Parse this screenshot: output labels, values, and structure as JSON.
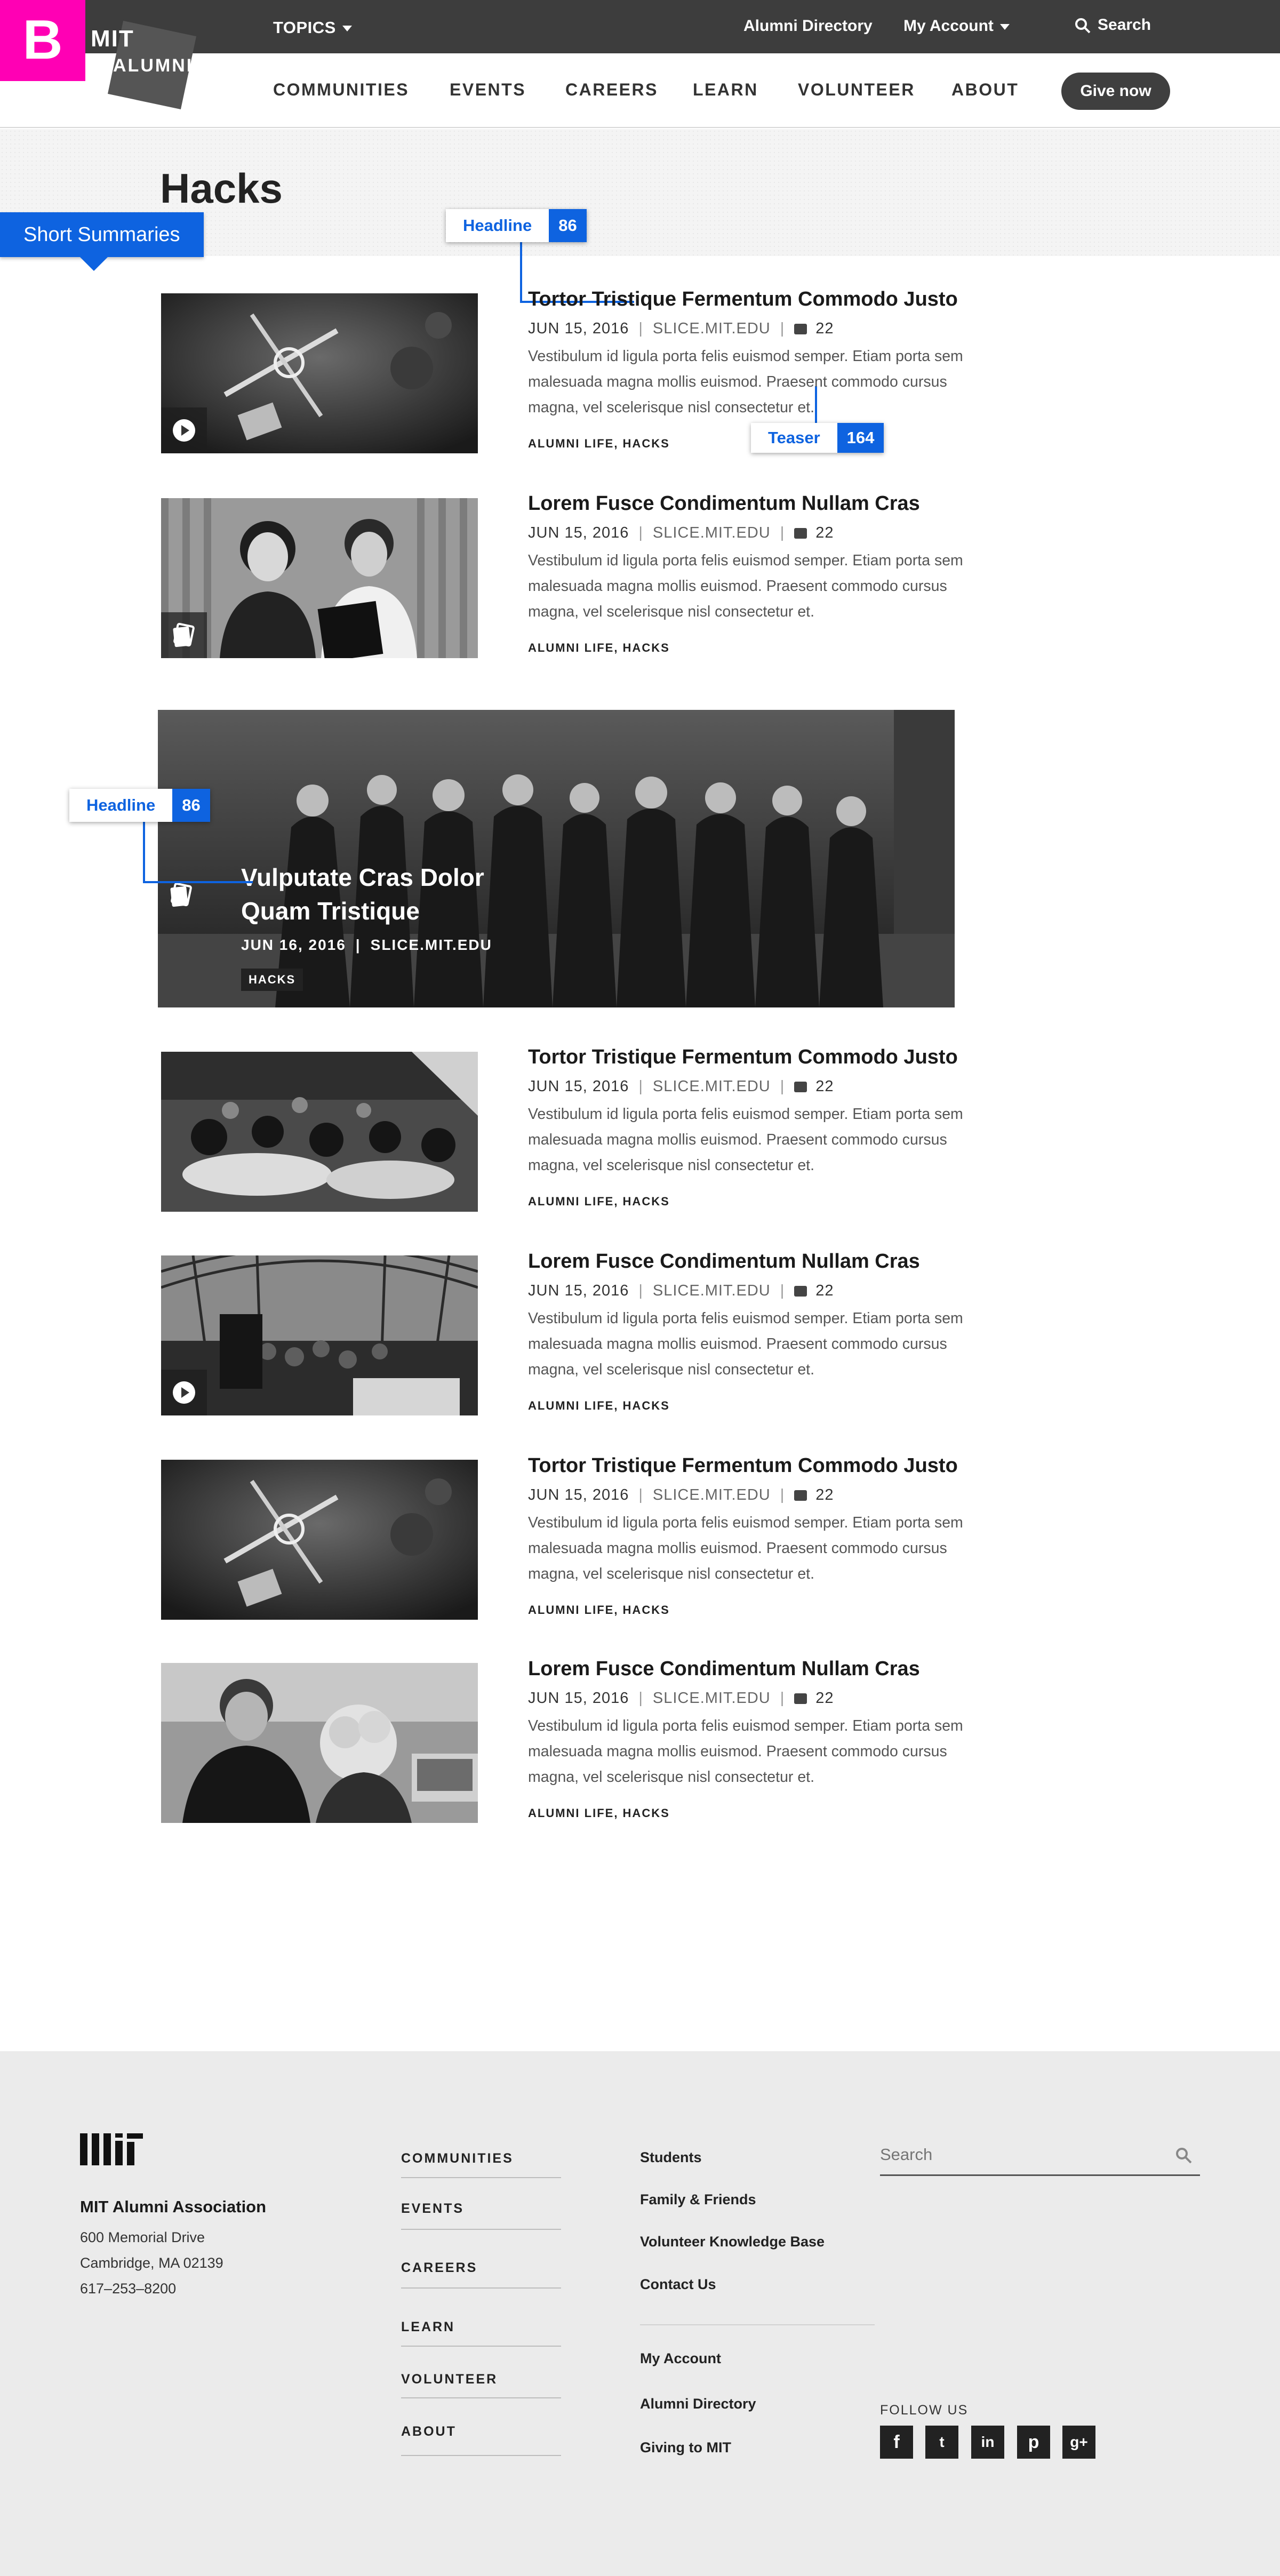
{
  "badge": {
    "letter": "B"
  },
  "logo": {
    "line1": "MIT",
    "line2": "ALUMNI"
  },
  "topbar": {
    "topics_label": "TOPICS",
    "directory_label": "Alumni Directory",
    "account_label": "My Account",
    "search_label": "Search"
  },
  "nav": {
    "items": [
      "COMMUNITIES",
      "EVENTS",
      "CAREERS",
      "LEARN",
      "VOLUNTEER",
      "ABOUT"
    ],
    "give_label": "Give now"
  },
  "page": {
    "title": "Hacks"
  },
  "annotations": {
    "section_tab": "Short Summaries",
    "headline_label": "Headline",
    "headline_count": "86",
    "teaser_label": "Teaser",
    "teaser_count": "164",
    "featured_headline_label": "Headline",
    "featured_headline_count": "86"
  },
  "articles": [
    {
      "title": "Tortor Tristique Fermentum Commodo Justo",
      "date": "JUN 15, 2016",
      "source": "SLICE.MIT.EDU",
      "comments": "22",
      "teaser": "Vestibulum id ligula porta felis euismod semper. Etiam porta sem malesuada magna mollis euismod. Praesent commodo cursus magna, vel scelerisque nisl consectetur et.",
      "tags": "ALUMNI LIFE, HACKS",
      "media": "video"
    },
    {
      "title": "Lorem Fusce Condimentum Nullam Cras",
      "date": "JUN 15, 2016",
      "source": "SLICE.MIT.EDU",
      "comments": "22",
      "teaser": "Vestibulum id ligula porta felis euismod semper. Etiam porta sem malesuada magna mollis euismod. Praesent commodo cursus magna, vel scelerisque nisl consectetur et.",
      "tags": "ALUMNI LIFE, HACKS",
      "media": "gallery"
    },
    {
      "title": "Tortor Tristique Fermentum Commodo Justo",
      "date": "JUN 15, 2016",
      "source": "SLICE.MIT.EDU",
      "comments": "22",
      "teaser": "Vestibulum id ligula porta felis euismod semper. Etiam porta sem malesuada magna mollis euismod. Praesent commodo cursus magna, vel scelerisque nisl consectetur et.",
      "tags": "ALUMNI LIFE, HACKS",
      "media": "none"
    },
    {
      "title": "Lorem Fusce Condimentum Nullam Cras",
      "date": "JUN 15, 2016",
      "source": "SLICE.MIT.EDU",
      "comments": "22",
      "teaser": "Vestibulum id ligula porta felis euismod semper. Etiam porta sem malesuada magna mollis euismod. Praesent commodo cursus magna, vel scelerisque nisl consectetur et.",
      "tags": "ALUMNI LIFE, HACKS",
      "media": "video"
    },
    {
      "title": "Tortor Tristique Fermentum Commodo Justo",
      "date": "JUN 15, 2016",
      "source": "SLICE.MIT.EDU",
      "comments": "22",
      "teaser": "Vestibulum id ligula porta felis euismod semper. Etiam porta sem malesuada magna mollis euismod. Praesent commodo cursus magna, vel scelerisque nisl consectetur et.",
      "tags": "ALUMNI LIFE, HACKS",
      "media": "none"
    },
    {
      "title": "Lorem Fusce Condimentum Nullam Cras",
      "date": "JUN 15, 2016",
      "source": "SLICE.MIT.EDU",
      "comments": "22",
      "teaser": "Vestibulum id ligula porta felis euismod semper. Etiam porta sem malesuada magna mollis euismod. Praesent commodo cursus magna, vel scelerisque nisl consectetur et.",
      "tags": "ALUMNI LIFE, HACKS",
      "media": "none"
    }
  ],
  "featured": {
    "title": "Vulputate Cras Dolor Quam Tristique",
    "date": "JUN 16, 2016",
    "source": "SLICE.MIT.EDU",
    "tag": "HACKS"
  },
  "footer": {
    "org": "MIT Alumni Association",
    "address": [
      "600 Memorial Drive",
      "Cambridge, MA 02139",
      "617–253–8200"
    ],
    "nav": [
      "COMMUNITIES",
      "EVENTS",
      "CAREERS",
      "LEARN",
      "VOLUNTEER",
      "ABOUT"
    ],
    "links_a": [
      "Students",
      "Family & Friends",
      "Volunteer Knowledge Base",
      "Contact Us"
    ],
    "links_b": [
      "My Account",
      "Alumni Directory",
      "Giving to MIT"
    ],
    "search_placeholder": "Search",
    "follow_label": "FOLLOW US",
    "social": [
      "f",
      "t",
      "in",
      "p",
      "g+"
    ]
  },
  "colors": {
    "accent": "#0e63e0",
    "badge": "#ff00b4",
    "topbar": "#3d3d3d",
    "footer": "#ebebeb"
  }
}
